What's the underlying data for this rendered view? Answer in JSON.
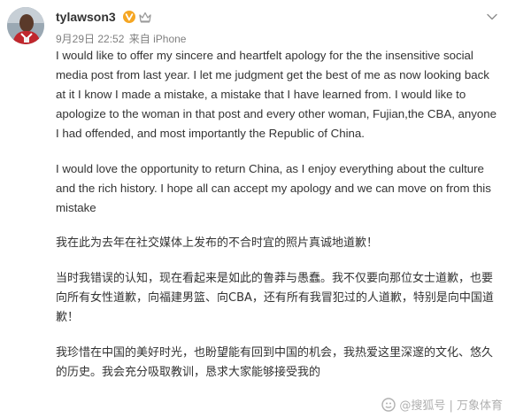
{
  "post": {
    "username": "tylawson3",
    "date": "9月29日 22:52",
    "source_prefix": "来自",
    "device": "iPhone",
    "paragraphs_en": [
      "I would like to offer my sincere and heartfelt apology for the the insensitive social media post from last year. I let me judgment get the best of me as now looking back at it I know I made a mistake, a mistake that I have learned from. I would like to apologize to the woman in that post and every other woman, Fujian,the CBA, anyone I had offended, and most importantly the Republic of China.",
      "I would love the opportunity  to return China, as I enjoy everything about the culture and the rich history. I hope all can accept my apology and we can move on from this mistake"
    ],
    "paragraphs_zh": [
      "我在此为去年在社交媒体上发布的不合时宜的照片真诚地道歉！",
      "当时我错误的认知，现在看起来是如此的鲁莽与愚蠢。我不仅要向那位女士道歉，也要向所有女性道歉，向福建男篮、向CBA，还有所有我冒犯过的人道歉，特别是向中国道歉！",
      "我珍惜在中国的美好时光，也盼望能有回到中国的机会，我热爱这里深邃的文化、悠久的历史。我会充分吸取教训，恳求大家能够接受我的"
    ]
  },
  "watermark": {
    "text": "@搜狐号 | 万象体育"
  },
  "icons": {
    "verified": "verified-v-badge-icon",
    "member": "crown-icon",
    "menu": "chevron-down-icon"
  },
  "colors": {
    "username": "#333333",
    "meta": "#808080",
    "verified": "#f5a623",
    "crown": "#ff8200",
    "text": "#333333"
  }
}
